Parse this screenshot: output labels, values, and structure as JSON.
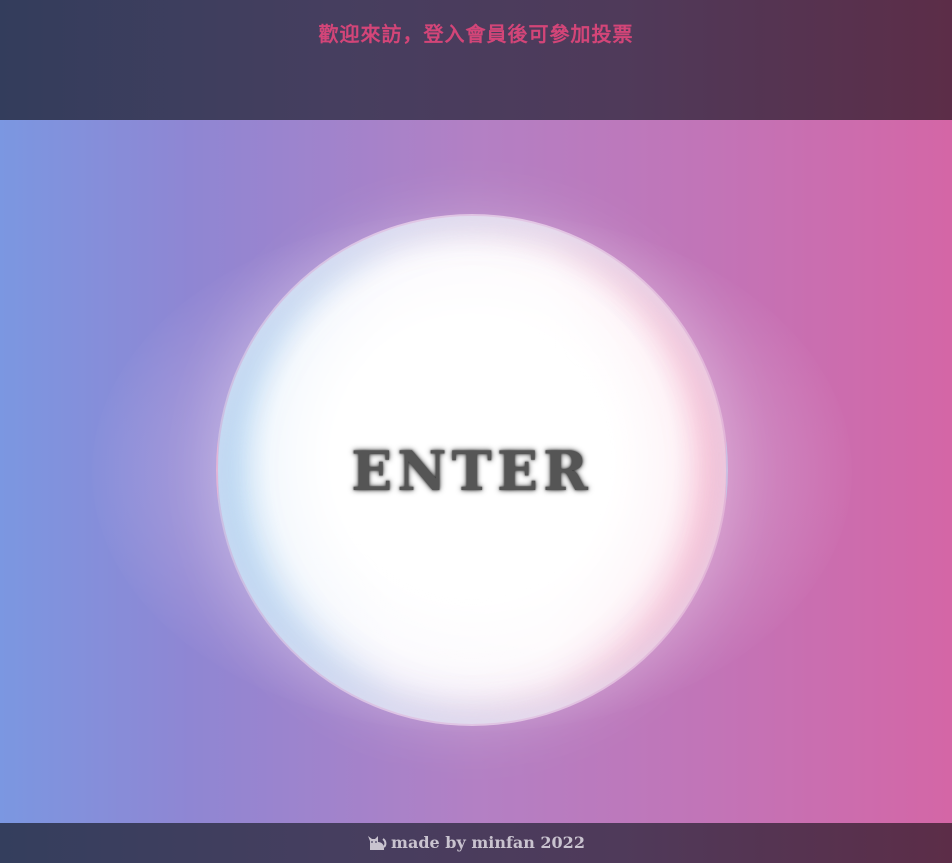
{
  "header": {
    "welcome_text": "歡迎來訪，登入會員後可參加投票"
  },
  "main": {
    "enter_label": "ENTER"
  },
  "footer": {
    "credit_text": "made by minfan 2022",
    "icon": "cat-icon"
  },
  "colors": {
    "header_text": "#d34578",
    "bar_background": "#463e5f",
    "enter_text": "#555555",
    "footer_text": "#c9c3cf"
  }
}
